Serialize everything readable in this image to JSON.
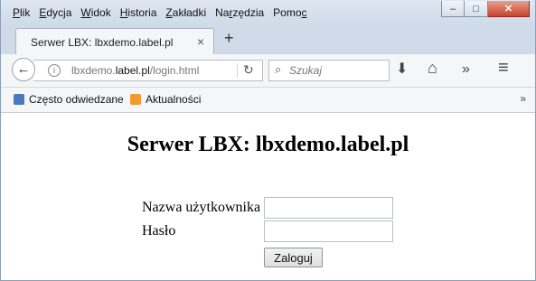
{
  "menu": [
    {
      "pre": "",
      "u": "P",
      "post": "lik"
    },
    {
      "pre": "",
      "u": "E",
      "post": "dycja"
    },
    {
      "pre": "",
      "u": "W",
      "post": "idok"
    },
    {
      "pre": "",
      "u": "H",
      "post": "istoria"
    },
    {
      "pre": "",
      "u": "Z",
      "post": "akładki"
    },
    {
      "pre": "Na",
      "u": "r",
      "post": "zędzia"
    },
    {
      "pre": "Pomo",
      "u": "c",
      "post": ""
    }
  ],
  "window_buttons": {
    "minimize": "–",
    "maximize": "□",
    "close": "✕"
  },
  "tab": {
    "title": "Serwer LBX: lbxdemo.label.pl",
    "close": "×",
    "new_tab": "+"
  },
  "urlbar": {
    "prefix": "lbxdemo.",
    "domain": "label.pl",
    "path": "/login.html",
    "reload": "↻"
  },
  "search": {
    "placeholder": "Szukaj",
    "icon": "search-icon"
  },
  "toolbar_icons": {
    "download": "⬇",
    "home": "⌂",
    "overflow": "»",
    "menu": "≡"
  },
  "bookmarks": {
    "items": [
      "Często odwiedzane",
      "Aktualności"
    ],
    "overflow": "»"
  },
  "page": {
    "heading": "Serwer LBX: lbxdemo.label.pl",
    "username_label": "Nazwa użytkownika",
    "password_label": "Hasło",
    "username_value": "",
    "password_value": "",
    "login_button": "Zaloguj"
  }
}
